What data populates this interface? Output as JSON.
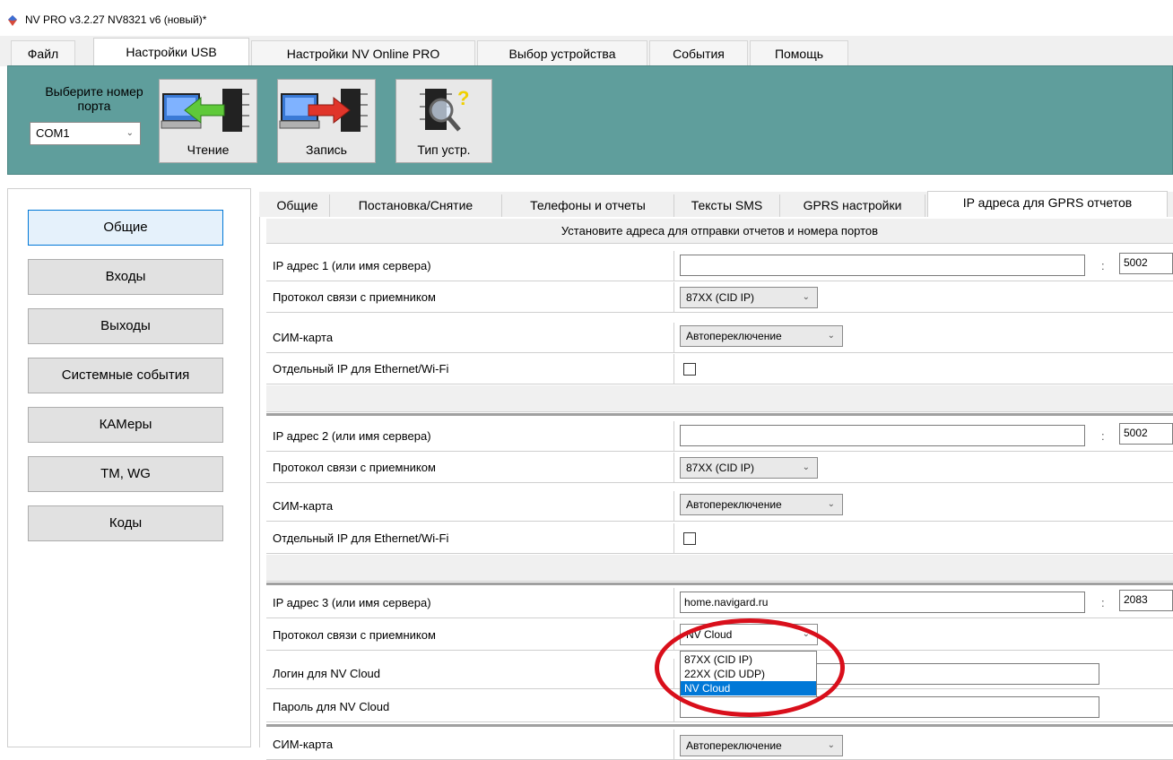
{
  "window": {
    "title": "NV PRO v3.2.27 NV8321 v6 (новый)*"
  },
  "menu_tabs": [
    "Файл",
    "Настройки USB",
    "Настройки NV Online PRO",
    "Выбор устройства",
    "События",
    "Помощь"
  ],
  "toolbar": {
    "port_label": "Выберите номер порта",
    "port_value": "COM1",
    "read_label": "Чтение",
    "write_label": "Запись",
    "type_label": "Тип устр."
  },
  "nav": [
    "Общие",
    "Входы",
    "Выходы",
    "Системные события",
    "КАМеры",
    "TM, WG",
    "Коды"
  ],
  "sub_tabs": [
    "Общие",
    "Постановка/Снятие",
    "Телефоны и отчеты",
    "Тексты SMS",
    "GPRS настройки",
    "IP адреса для GPRS отчетов"
  ],
  "content": {
    "heading": "Установите адреса для отправки отчетов и номера портов",
    "block1": {
      "ip_label": "IP адрес 1 (или имя сервера)",
      "ip_value": "",
      "port": "5002",
      "proto_label": "Протокол связи с приемником",
      "proto_value": "87XX (CID IP)",
      "sim_label": "СИМ-карта",
      "sim_value": "Автопереключение",
      "eth_label": "Отдельный IP для Ethernet/Wi-Fi"
    },
    "block2": {
      "ip_label": "IP адрес 2 (или имя сервера)",
      "ip_value": "",
      "port": "5002",
      "proto_label": "Протокол связи с приемником",
      "proto_value": "87XX (CID IP)",
      "sim_label": "СИМ-карта",
      "sim_value": "Автопереключение",
      "eth_label": "Отдельный IP для Ethernet/Wi-Fi"
    },
    "block3": {
      "ip_label": "IP адрес 3 (или имя сервера)",
      "ip_value": "home.navigard.ru",
      "port": "2083",
      "proto_label": "Протокол связи с приемником",
      "proto_value": "NV Cloud",
      "login_label": "Логин для NV Cloud",
      "pass_label": "Пароль для NV Cloud",
      "sim_label": "СИМ-карта",
      "sim_value": "Автопереключение"
    },
    "dropdown_options": [
      "87XX (CID IP)",
      "22XX (CID UDP)",
      "NV Cloud"
    ],
    "dropdown_selected": "NV Cloud"
  },
  "colors": {
    "toolbar": "#5f9e9c",
    "selection": "#0078d7",
    "annotation": "#d90f1b"
  }
}
